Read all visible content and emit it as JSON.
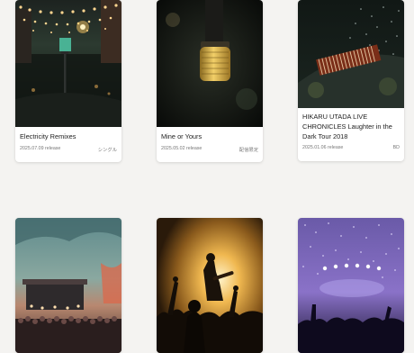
{
  "releases": [
    {
      "title": "Electricity Remixes",
      "date": "2025.07.09 release",
      "format": "シングル",
      "artwork": "night-street-lanterns-photo"
    },
    {
      "title": "Mine or Yours",
      "date": "2025.05.02 release",
      "format": "配信限定",
      "artwork": "vintage-microphone-photo"
    },
    {
      "title": "HIKARU UTADA LIVE CHRONICLES Laughter in the Dark Tour 2018",
      "date": "2025.01.06 release",
      "format": "BD",
      "artwork": "stage-piano-confetti-photo"
    },
    {
      "title": "",
      "date": "",
      "format": "",
      "artwork": "outdoor-festival-stage-photo"
    },
    {
      "title": "",
      "date": "",
      "format": "",
      "artwork": "concert-crowd-spotlight-photo"
    },
    {
      "title": "",
      "date": "",
      "format": "",
      "artwork": "purple-confetti-stage-photo"
    }
  ]
}
